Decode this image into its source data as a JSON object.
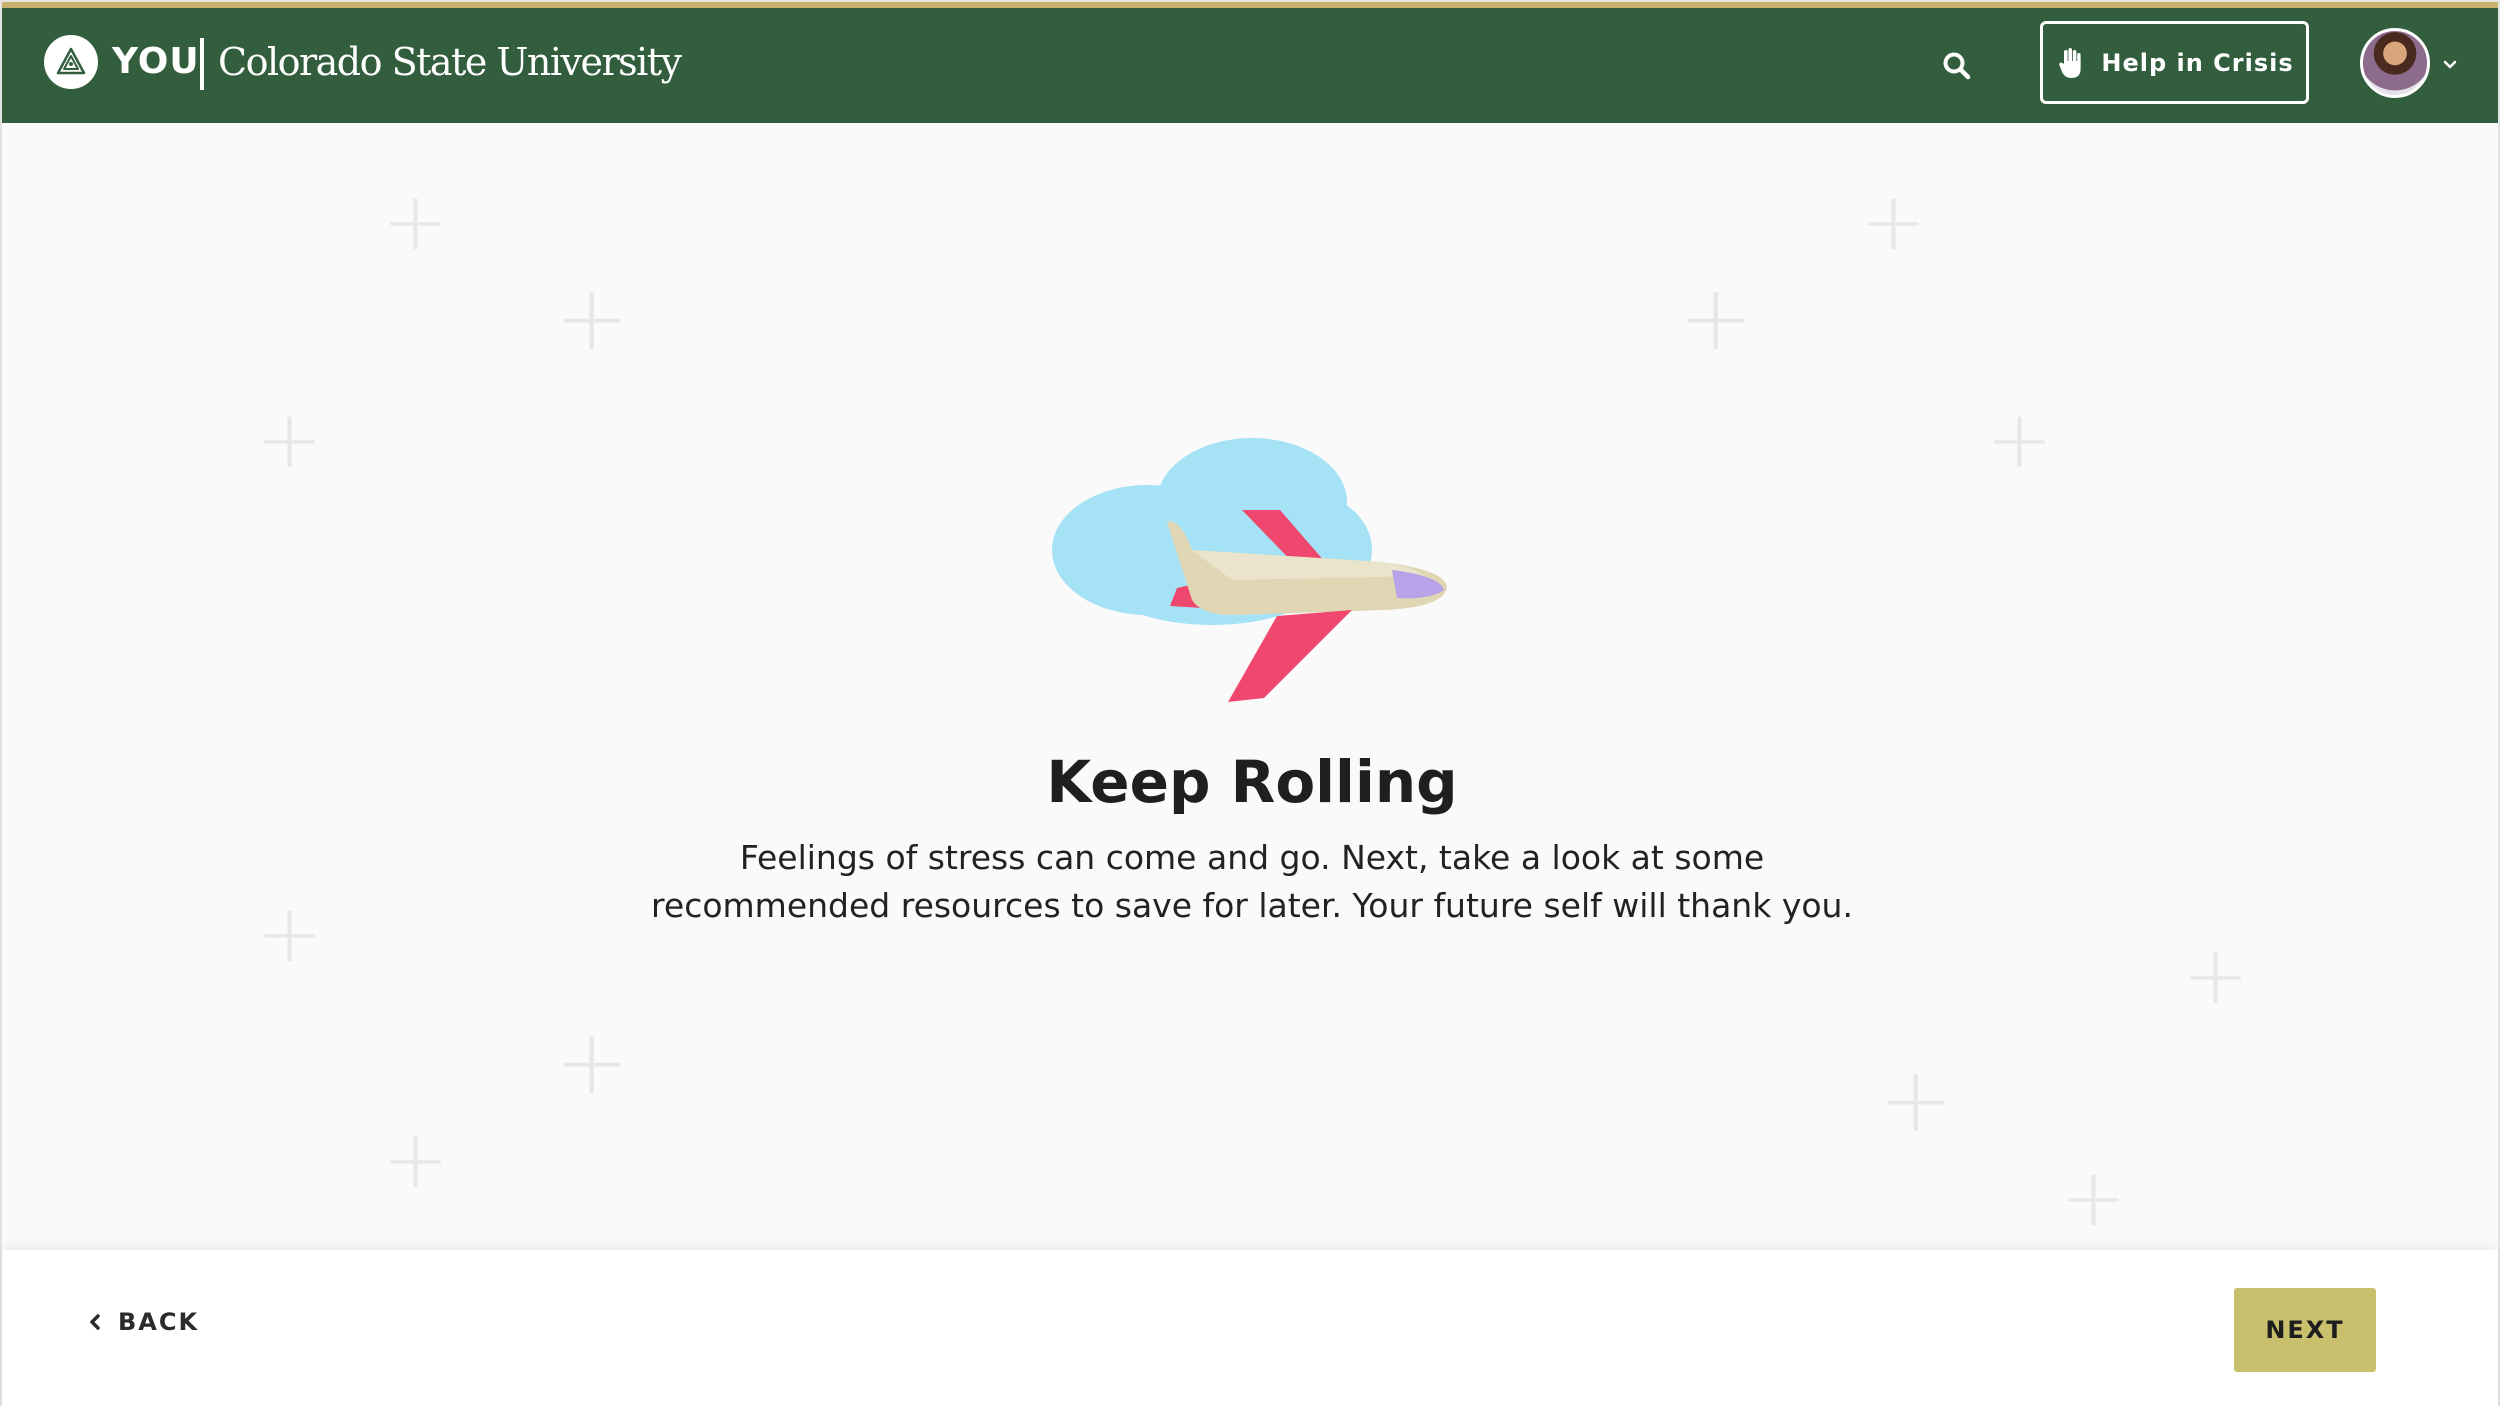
{
  "header": {
    "brand_short": "YOU",
    "brand_school": "Colorado State University",
    "crisis_label": "Help in Crisis",
    "icons": {
      "logo": "triangle-logo-icon",
      "search": "search-icon",
      "crisis": "raised-hand-icon",
      "caret": "chevron-down-icon"
    }
  },
  "main": {
    "title": "Keep Rolling",
    "body_line_1": "Feelings of stress can come and go. Next, take a look at some",
    "body_line_2": "recommended resources to save for later. Your future self will thank you.",
    "illustration": "airplane-with-cloud"
  },
  "footer": {
    "back_label": "BACK",
    "next_label": "NEXT"
  },
  "colors": {
    "header_green": "#335e3e",
    "gold_strip": "#c8b16d",
    "next_button": "#c9c06e",
    "cloud_blue": "#a6e2f6",
    "plane_body": "#e0d6b4",
    "plane_wing": "#f0476f"
  }
}
